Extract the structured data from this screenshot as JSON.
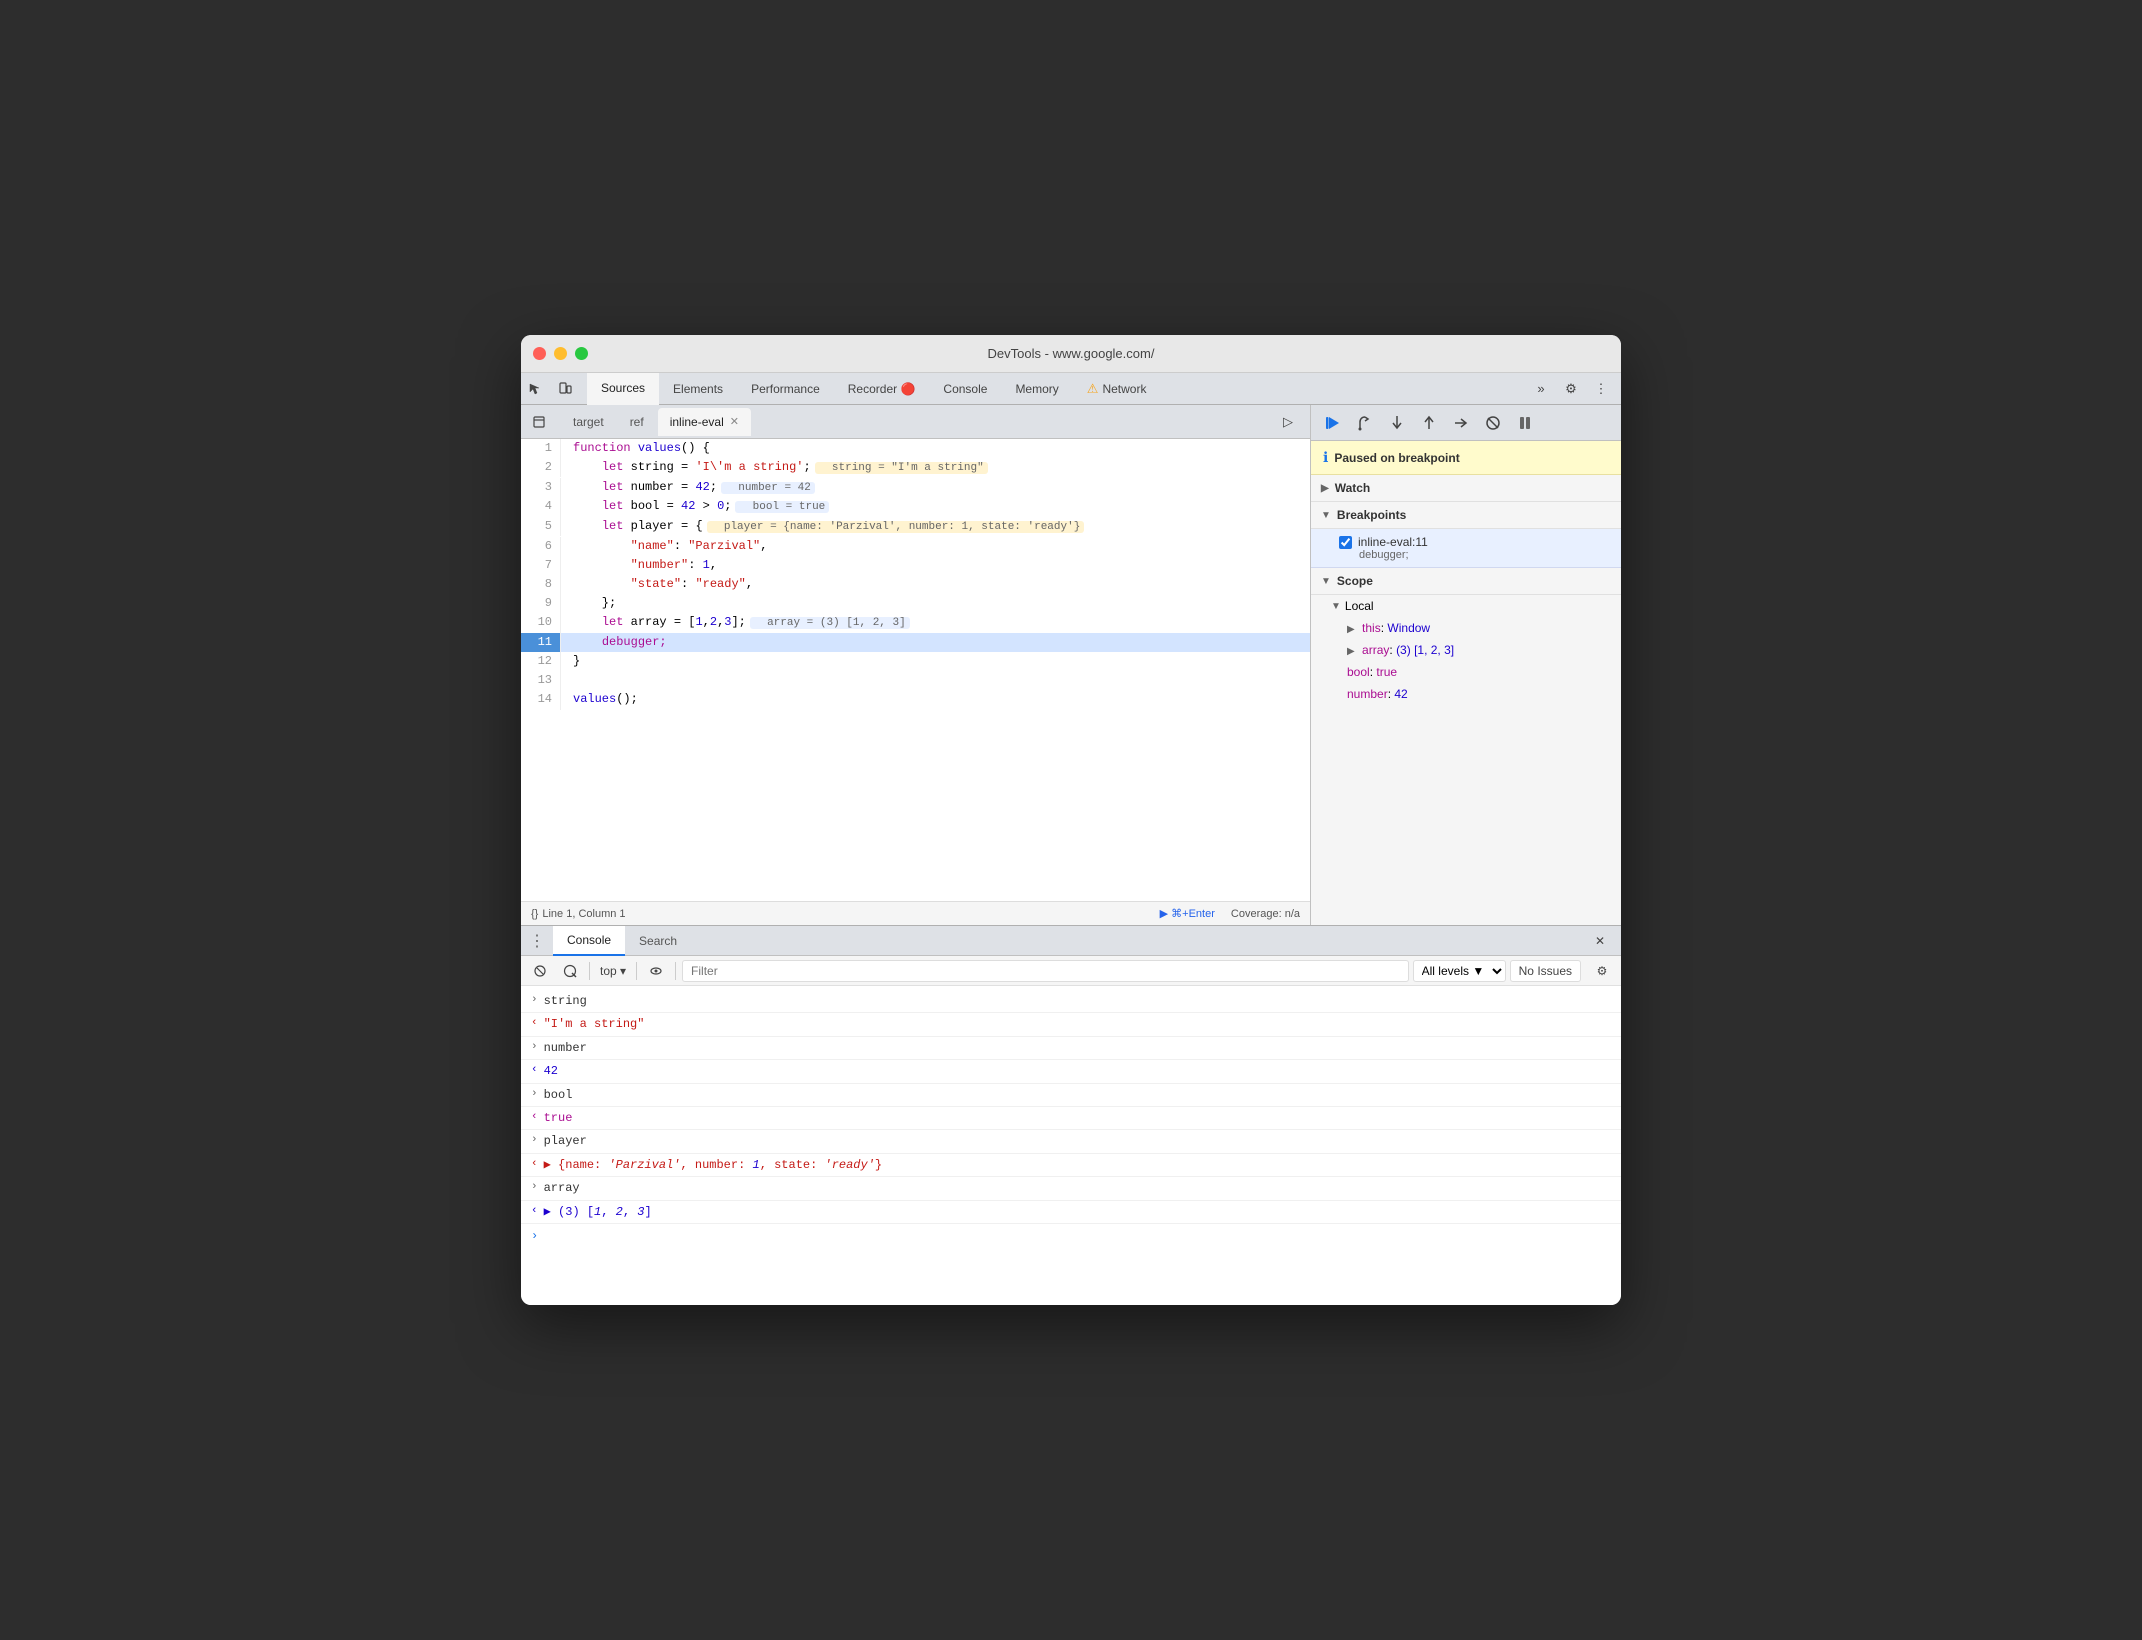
{
  "window": {
    "title": "DevTools - www.google.com/"
  },
  "traffic_lights": {
    "red": "close",
    "yellow": "minimize",
    "green": "maximize"
  },
  "main_tabs": {
    "items": [
      {
        "id": "sources",
        "label": "Sources",
        "active": true
      },
      {
        "id": "elements",
        "label": "Elements",
        "active": false
      },
      {
        "id": "performance",
        "label": "Performance",
        "active": false
      },
      {
        "id": "recorder",
        "label": "Recorder 🔴",
        "active": false
      },
      {
        "id": "console",
        "label": "Console",
        "active": false
      },
      {
        "id": "memory",
        "label": "Memory",
        "active": false
      },
      {
        "id": "network",
        "label": "Network",
        "active": false
      }
    ],
    "more_label": "»",
    "settings_label": "⚙",
    "customize_label": "⋮"
  },
  "source_tabs": {
    "items": [
      {
        "id": "target",
        "label": "target",
        "closable": false
      },
      {
        "id": "ref",
        "label": "ref",
        "closable": false
      },
      {
        "id": "inline-eval",
        "label": "inline-eval",
        "closable": true,
        "active": true
      }
    ],
    "broadcast_label": "▷"
  },
  "code": {
    "lines": [
      {
        "num": 1,
        "content": "function values() {",
        "highlighted": false
      },
      {
        "num": 2,
        "content": "    let string = 'I\\'m a string';  string = \"I'm a string\"",
        "highlighted": false,
        "has_inline": true,
        "inline": "string = \"I'm a string\""
      },
      {
        "num": 3,
        "content": "    let number = 42;  number = 42",
        "highlighted": false,
        "has_inline": true,
        "inline": "number = 42"
      },
      {
        "num": 4,
        "content": "    let bool = 42 > 0;  bool = true",
        "highlighted": false,
        "has_inline": true,
        "inline": "bool = true"
      },
      {
        "num": 5,
        "content": "    let player = {  player = {name: 'Parzival', number: 1, state: 'ready'}",
        "highlighted": false
      },
      {
        "num": 6,
        "content": "        \"name\": \"Parzival\",",
        "highlighted": false
      },
      {
        "num": 7,
        "content": "        \"number\": 1,",
        "highlighted": false
      },
      {
        "num": 8,
        "content": "        \"state\": \"ready\",",
        "highlighted": false
      },
      {
        "num": 9,
        "content": "    };",
        "highlighted": false
      },
      {
        "num": 10,
        "content": "    let array = [1,2,3];  array = (3) [1, 2, 3]",
        "highlighted": false
      },
      {
        "num": 11,
        "content": "    debugger;",
        "highlighted": true,
        "is_debugger": true
      },
      {
        "num": 12,
        "content": "}",
        "highlighted": false
      },
      {
        "num": 13,
        "content": "",
        "highlighted": false
      },
      {
        "num": 14,
        "content": "values();",
        "highlighted": false
      }
    ]
  },
  "status_bar": {
    "bracket_label": "{}",
    "position_label": "Line 1, Column 1",
    "run_label": "▶ ⌘+Enter",
    "coverage_label": "Coverage: n/a"
  },
  "debug_toolbar": {
    "buttons": [
      {
        "id": "resume",
        "label": "▶",
        "title": "Resume script execution",
        "active": true
      },
      {
        "id": "step-over",
        "label": "↺",
        "title": "Step over next function call"
      },
      {
        "id": "step-into",
        "label": "↓",
        "title": "Step into next function call"
      },
      {
        "id": "step-out",
        "label": "↑",
        "title": "Step out of current function"
      },
      {
        "id": "step",
        "label": "→",
        "title": "Step"
      },
      {
        "id": "deactivate",
        "label": "⊘",
        "title": "Deactivate breakpoints"
      },
      {
        "id": "pause-on-exception",
        "label": "⏸",
        "title": "Pause on exceptions"
      }
    ]
  },
  "debugger_panel": {
    "breakpoint_info": "Paused on breakpoint",
    "watch_label": "Watch",
    "breakpoints_label": "Breakpoints",
    "breakpoints": [
      {
        "id": "inline-eval-11",
        "label": "inline-eval:11",
        "statement": "debugger;",
        "checked": true
      }
    ],
    "scope_label": "Scope",
    "local_label": "Local",
    "scope_items": [
      {
        "key": "this",
        "value": "Window",
        "expandable": true
      },
      {
        "key": "array",
        "value": "(3) [1, 2, 3]",
        "expandable": true
      },
      {
        "key": "bool",
        "value": "true",
        "type": "bool"
      },
      {
        "key": "number",
        "value": "42",
        "type": "num"
      }
    ]
  },
  "console": {
    "tabs": [
      {
        "id": "console",
        "label": "Console",
        "active": true
      },
      {
        "id": "search",
        "label": "Search",
        "active": false
      }
    ],
    "toolbar": {
      "filter_placeholder": "Filter",
      "levels_label": "All levels ▼",
      "no_issues_label": "No Issues"
    },
    "output": [
      {
        "type": "expand",
        "arrow": "›",
        "text": "string"
      },
      {
        "type": "result",
        "arrow": "‹",
        "text": "\"I'm a string\"",
        "style": "string-out"
      },
      {
        "type": "expand",
        "arrow": "›",
        "text": "number"
      },
      {
        "type": "result",
        "arrow": "‹",
        "text": "42",
        "style": "num-out"
      },
      {
        "type": "expand",
        "arrow": "›",
        "text": "bool"
      },
      {
        "type": "result",
        "arrow": "‹",
        "text": "true",
        "style": "bool-out"
      },
      {
        "type": "expand",
        "arrow": "›",
        "text": "player"
      },
      {
        "type": "result",
        "arrow": "‹",
        "text": "▶ {name: 'Parzival', number: 1, state: 'ready'}",
        "style": "string-out",
        "expandable": true
      },
      {
        "type": "expand",
        "arrow": "›",
        "text": "array"
      },
      {
        "type": "result",
        "arrow": "‹",
        "text": "▶ (3) [1, 2, 3]",
        "style": "num-out",
        "expandable": true
      }
    ]
  }
}
